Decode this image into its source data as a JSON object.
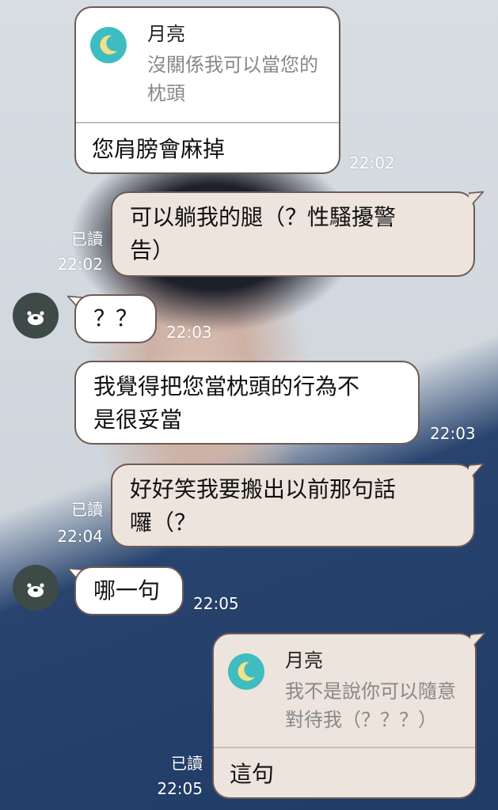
{
  "messages": {
    "m1": {
      "quote_name": "月亮",
      "quote_line1": "沒關係我可以當您的",
      "quote_line2": "枕頭",
      "reply": "您肩膀會麻掉",
      "time": "22:02"
    },
    "m2": {
      "line1": "可以躺我的腿（？性騷擾警",
      "line2": "告）",
      "read": "已讀",
      "time": "22:02"
    },
    "m3": {
      "text": "？？",
      "time": "22:03"
    },
    "m4": {
      "line1": "我覺得把您當枕頭的行為不",
      "line2": "是很妥當",
      "time": "22:03"
    },
    "m5": {
      "line1": "好好笑我要搬出以前那句話",
      "line2": "囉（？",
      "read": "已讀",
      "time": "22:04"
    },
    "m6": {
      "text": "哪一句",
      "time": "22:05"
    },
    "m7": {
      "quote_name": "月亮",
      "quote_line1": "我不是說你可以隨意",
      "quote_line2": "對待我（？？？）",
      "reply": "這句",
      "read": "已讀",
      "time": "22:05"
    }
  },
  "colors": {
    "bubble_in": "#ffffff",
    "bubble_out": "#ece4dd",
    "bubble_border": "#6e5a55",
    "moon_avatar": "#3fbcc0",
    "friend_avatar": "#3e4a47"
  },
  "icons": {
    "friend_avatar": "dark-bear-face-icon",
    "quote_avatar": "crescent-moon-icon"
  }
}
